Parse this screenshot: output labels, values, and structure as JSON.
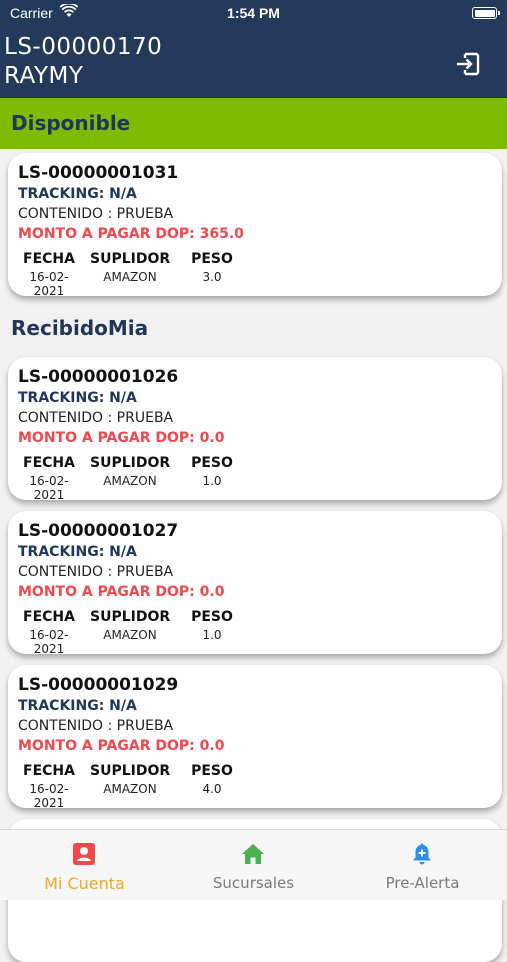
{
  "status_bar": {
    "carrier": "Carrier",
    "time": "1:54 PM"
  },
  "header": {
    "account_code": "LS-00000170",
    "account_name": "RAYMY"
  },
  "sections": [
    {
      "title": "Disponible",
      "packages": [
        {
          "code": "LS-00000001031",
          "tracking": "TRACKING: N/A",
          "contenido": "CONTENIDO : PRUEBA",
          "monto": "MONTO A PAGAR  DOP: 365.0",
          "fecha": "16-02-2021",
          "suplidor": "AMAZON",
          "peso": "3.0"
        }
      ]
    },
    {
      "title": "RecibidoMia",
      "packages": [
        {
          "code": "LS-00000001026",
          "tracking": "TRACKING: N/A",
          "contenido": "CONTENIDO : PRUEBA",
          "monto": "MONTO A PAGAR  DOP: 0.0",
          "fecha": "16-02-2021",
          "suplidor": "AMAZON",
          "peso": "1.0"
        },
        {
          "code": "LS-00000001027",
          "tracking": "TRACKING: N/A",
          "contenido": "CONTENIDO : PRUEBA",
          "monto": "MONTO A PAGAR  DOP: 0.0",
          "fecha": "16-02-2021",
          "suplidor": "AMAZON",
          "peso": "1.0"
        },
        {
          "code": "LS-00000001029",
          "tracking": "TRACKING: N/A",
          "contenido": "CONTENIDO : PRUEBA",
          "monto": "MONTO A PAGAR  DOP: 0.0",
          "fecha": "16-02-2021",
          "suplidor": "AMAZON",
          "peso": "4.0"
        }
      ]
    }
  ],
  "column_headers": {
    "fecha": "FECHA",
    "suplidor": "SUPLIDOR",
    "peso": "PESO"
  },
  "bottom_nav": [
    {
      "label": "Mi Cuenta",
      "icon": "user-account-icon",
      "active": true
    },
    {
      "label": "Sucursales",
      "icon": "home-icon",
      "active": false
    },
    {
      "label": "Pre-Alerta",
      "icon": "bell-plus-icon",
      "active": false
    }
  ],
  "colors": {
    "header_bg": "#243a5a",
    "section_green": "#7fbb00",
    "navy_text": "#20365a",
    "amount_red": "#f0484d",
    "active_tab": "#f5a623",
    "home_icon": "#4caf50",
    "bell_icon": "#2f8cf0",
    "account_icon": "#f0484d"
  }
}
